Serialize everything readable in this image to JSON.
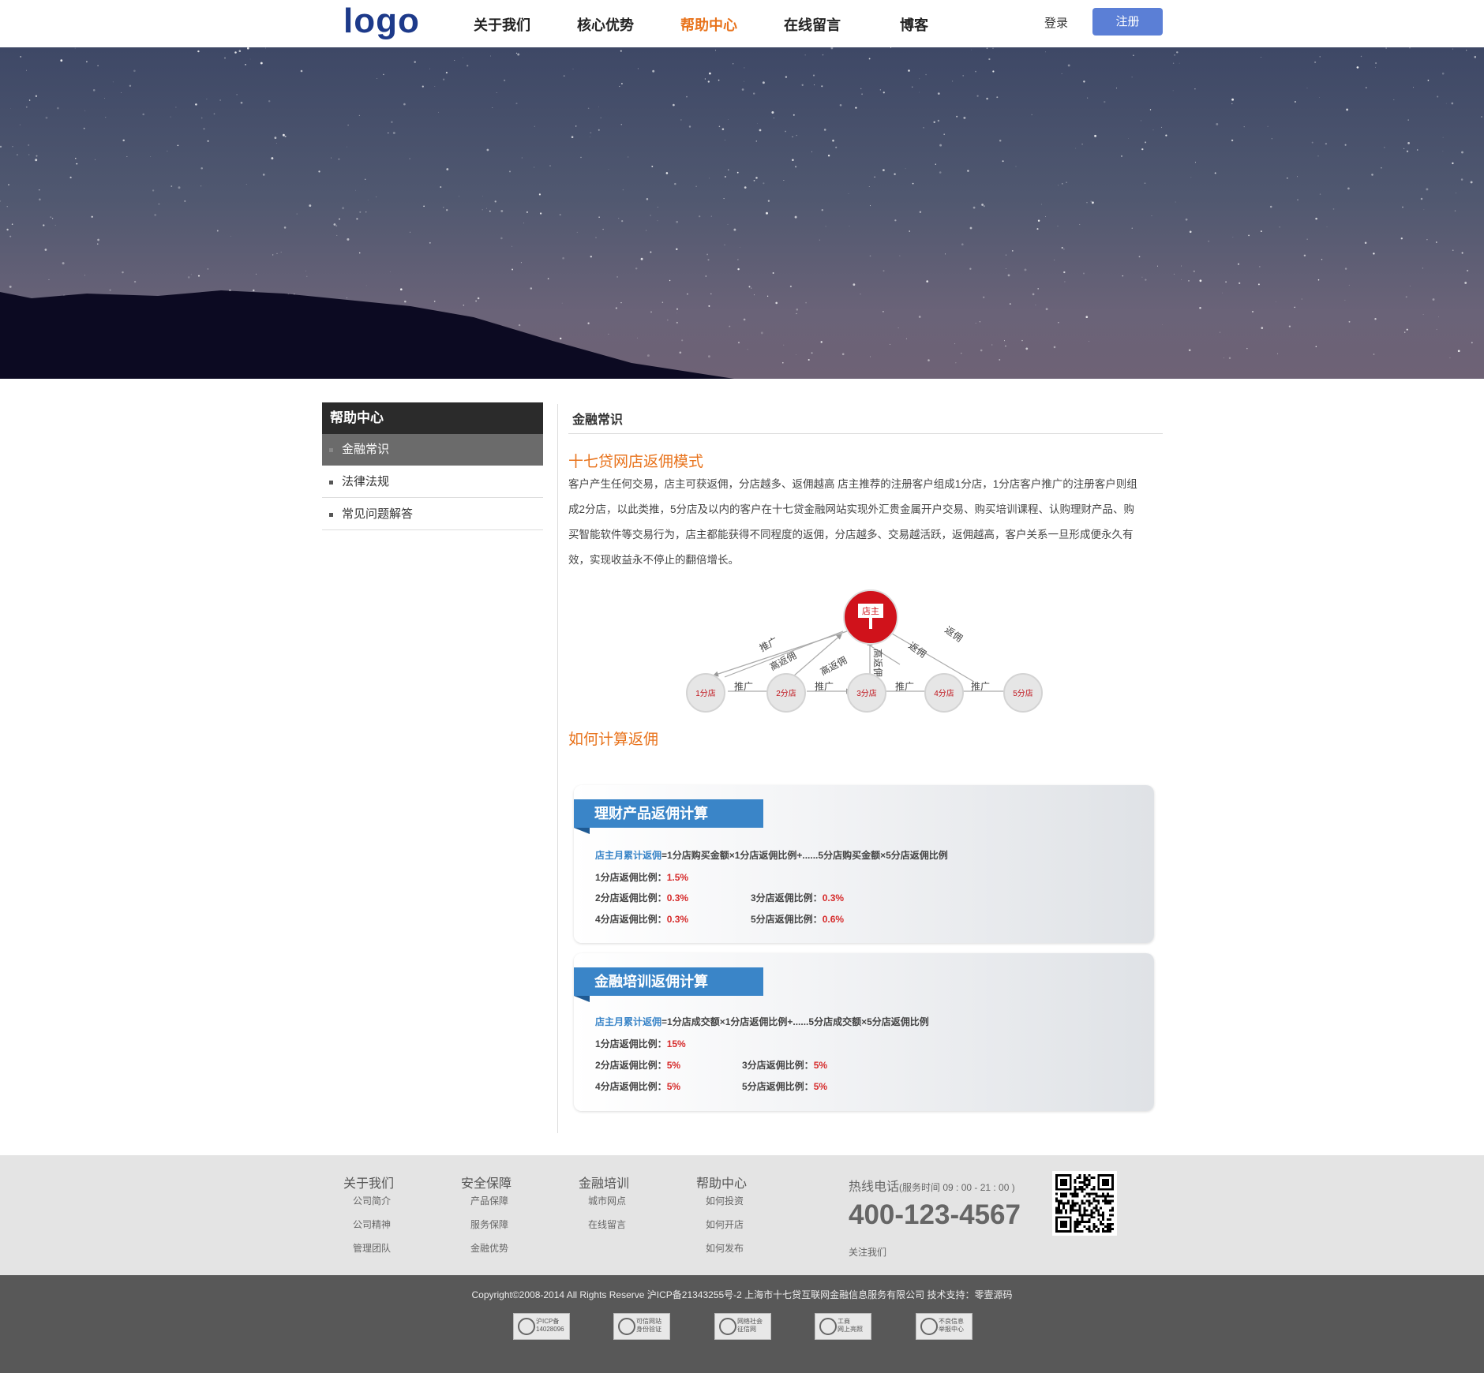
{
  "header": {
    "logo": "logo",
    "nav": [
      "关于我们",
      "核心优势",
      "帮助中心",
      "在线留言",
      "博客"
    ],
    "login": "登录",
    "register": "注册"
  },
  "sidebar": {
    "title": "帮助中心",
    "items": [
      "金融常识",
      "法律法规",
      "常见问题解答"
    ]
  },
  "content": {
    "crumb": "金融常识",
    "section1_title": "十七贷网店返佣模式",
    "section1_lines": [
      "客户产生任何交易，店主可获返佣，分店越多、返佣越高 店主推荐的注册客户组成1分店，1分店客户推广的注册客户则组",
      "成2分店，以此类推，5分店及以内的客户在十七贷金融网站实现外汇贵金属开户交易、购买培训课程、认购理财产品、购",
      "买智能软件等交易行为，店主都能获得不同程度的返佣，分店越多、交易越活跃，返佣越高，客户关系一旦形成便永久有",
      "效，实现收益永不停止的翻倍增长。"
    ],
    "diagram": {
      "owner": "店主",
      "stores": [
        "1分店",
        "2分店",
        "3分店",
        "4分店",
        "5分店"
      ],
      "promote": "推广",
      "high_rebate": "高返佣",
      "rebate": "返佣"
    },
    "section2_title": "如何计算返佣",
    "calc1": {
      "title": "理财产品返佣计算",
      "formula_label": "店主月累计返佣",
      "formula_body": "=1分店购买金额×1分店返佣比例+......5分店购买金额×5分店返佣比例",
      "r1_label": "1分店返佣比例：",
      "r1_value": "1.5%",
      "r2_label": "2分店返佣比例：",
      "r2_value": "0.3%",
      "r3_label": "3分店返佣比例：",
      "r3_value": "0.3%",
      "r4_label": "4分店返佣比例：",
      "r4_value": "0.3%",
      "r5_label": "5分店返佣比例：",
      "r5_value": "0.6%"
    },
    "calc2": {
      "title": "金融培训返佣计算",
      "formula_label": "店主月累计返佣",
      "formula_body": "=1分店成交额×1分店返佣比例+......5分店成交额×5分店返佣比例",
      "r1_label": "1分店返佣比例：",
      "r1_value": "15%",
      "r2_label": "2分店返佣比例：",
      "r2_value": "5%",
      "r3_label": "3分店返佣比例：",
      "r3_value": "5%",
      "r4_label": "4分店返佣比例：",
      "r4_value": "5%",
      "r5_label": "5分店返佣比例：",
      "r5_value": "5%"
    }
  },
  "footer": {
    "columns": [
      {
        "title": "关于我们",
        "links": [
          "公司简介",
          "公司精神",
          "管理团队"
        ]
      },
      {
        "title": "安全保障",
        "links": [
          "产品保障",
          "服务保障",
          "金融优势"
        ]
      },
      {
        "title": "金融培训",
        "links": [
          "城市网点",
          "在线留言"
        ]
      },
      {
        "title": "帮助中心",
        "links": [
          "如何投资",
          "如何开店",
          "如何发布"
        ]
      }
    ],
    "hotline_label": "热线电话",
    "hotline_hours": "(服务时间 09 : 00 - 21 : 00 )",
    "phone": "400-123-4567",
    "follow": "关注我们",
    "copyright": "Copyright©2008-2014 All Rights Reserve 沪ICP备21343255号-2 上海市十七贷互联网金融信息服务有限公司   技术支持：零壹源码",
    "badges": [
      [
        "沪ICP备",
        "14028096"
      ],
      [
        "可信网站",
        "身份验证"
      ],
      [
        "网络社会",
        "征信网"
      ],
      [
        "工商",
        "网上亮照"
      ],
      [
        "不良信息",
        "举报中心"
      ]
    ]
  },
  "colors": {
    "accent": "#e8731c",
    "primary": "#5b7fd6",
    "calc_blue": "#3a85c8",
    "red": "#d62b2b"
  }
}
